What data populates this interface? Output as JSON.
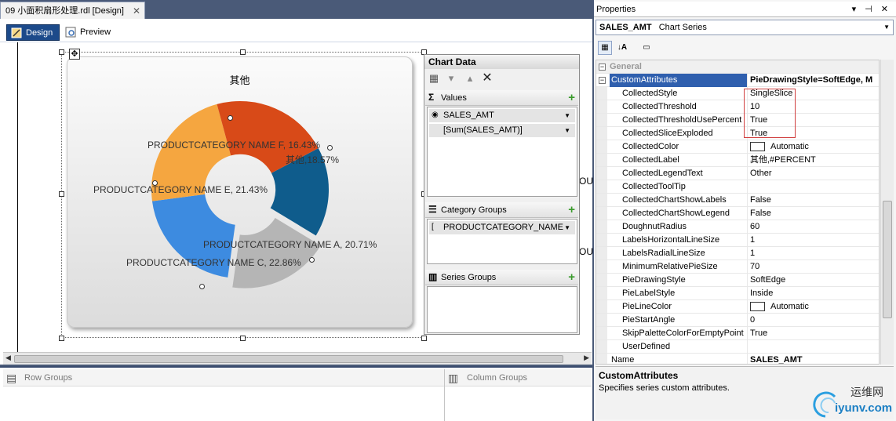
{
  "document": {
    "tab_title": "09 小面积扇形处理.rdl [Design]",
    "view_tabs": [
      "Design",
      "Preview"
    ]
  },
  "chart": {
    "title": "其他",
    "labels": [
      {
        "text": "PRODUCTCATEGORY NAME F, 16.43%"
      },
      {
        "text": "其他,18.57%"
      },
      {
        "text": "PRODUCTCATEGORY NAME E, 21.43%"
      },
      {
        "text": "PRODUCTCATEGORY NAME A, 20.71%"
      },
      {
        "text": "PRODUCTCATEGORY NAME C, 22.86%"
      }
    ],
    "behind_fragments": [
      "OU",
      "OU"
    ]
  },
  "chart_data": {
    "type": "pie",
    "categories": [
      "PRODUCTCATEGORY NAME F",
      "其他",
      "PRODUCTCATEGORY NAME A",
      "PRODUCTCATEGORY NAME C",
      "PRODUCTCATEGORY NAME E"
    ],
    "values": [
      16.43,
      18.57,
      20.71,
      22.86,
      21.43
    ],
    "colors": [
      "#0f5c8c",
      "#b5b5b5",
      "#3d8be0",
      "#f5a640",
      "#d84a18"
    ],
    "title": "其他",
    "doughnut_radius": 60,
    "exploded": [
      "其他"
    ]
  },
  "chart_panel": {
    "title": "Chart Data",
    "values_header": "Values",
    "values_items": [
      "SALES_AMT",
      "[Sum(SALES_AMT)]"
    ],
    "category_header": "Category Groups",
    "category_items": [
      "PRODUCTCATEGORY_NAME"
    ],
    "series_header": "Series Groups"
  },
  "groups": {
    "row": "Row Groups",
    "column": "Column Groups"
  },
  "properties": {
    "title": "Properties",
    "controls": "▾ ⊣ ✕",
    "object_name": "SALES_AMT",
    "object_type": "Chart Series",
    "category_general": "General",
    "rows": [
      {
        "name": "CustomAttributes",
        "value": "PieDrawingStyle=SoftEdge, M"
      },
      {
        "name": "CollectedStyle",
        "value": "SingleSlice"
      },
      {
        "name": "CollectedThreshold",
        "value": "10"
      },
      {
        "name": "CollectedThresholdUsePercent",
        "value": "True"
      },
      {
        "name": "CollectedSliceExploded",
        "value": "True"
      },
      {
        "name": "CollectedColor",
        "value": "Automatic"
      },
      {
        "name": "CollectedLabel",
        "value": "其他,#PERCENT"
      },
      {
        "name": "CollectedLegendText",
        "value": "Other"
      },
      {
        "name": "CollectedToolTip",
        "value": ""
      },
      {
        "name": "CollectedChartShowLabels",
        "value": "False"
      },
      {
        "name": "CollectedChartShowLegend",
        "value": "False"
      },
      {
        "name": "DoughnutRadius",
        "value": "60"
      },
      {
        "name": "LabelsHorizontalLineSize",
        "value": "1"
      },
      {
        "name": "LabelsRadialLineSize",
        "value": "1"
      },
      {
        "name": "MinimumRelativePieSize",
        "value": "70"
      },
      {
        "name": "PieDrawingStyle",
        "value": "SoftEdge"
      },
      {
        "name": "PieLabelStyle",
        "value": "Inside"
      },
      {
        "name": "PieLineColor",
        "value": "Automatic"
      },
      {
        "name": "PieStartAngle",
        "value": "0"
      },
      {
        "name": "SkipPaletteColorForEmptyPoint",
        "value": "True"
      },
      {
        "name": "UserDefined",
        "value": ""
      },
      {
        "name": "Name",
        "value": "SALES_AMT"
      }
    ],
    "desc_title": "CustomAttributes",
    "desc_text": "Specifies series custom attributes."
  },
  "watermark": {
    "text_cn": "运维网",
    "text_url": "iyunv.com"
  }
}
